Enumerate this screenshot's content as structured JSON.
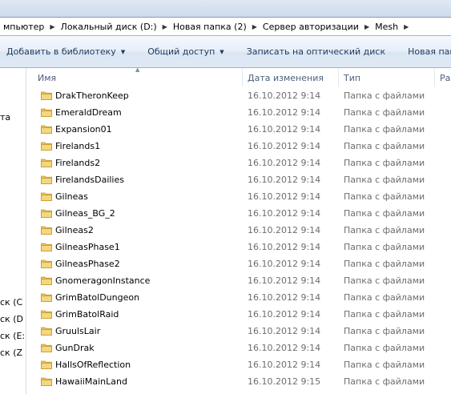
{
  "breadcrumb": {
    "items": [
      "мпьютер",
      "Локальный диск (D:)",
      "Новая папка (2)",
      "Сервер авторизации",
      "Mesh"
    ],
    "separator_icon": "chevron-right-icon"
  },
  "toolbar": {
    "library_label": "Добавить в библиотеку",
    "share_label": "Общий доступ",
    "burn_label": "Записать на оптический диск",
    "new_folder_label": "Новая папка"
  },
  "nav": {
    "items": [
      "та",
      "ск (C",
      "ск (D",
      "ск (E:",
      "ск (Z"
    ]
  },
  "columns": {
    "name": "Имя",
    "date": "Дата изменения",
    "type": "Тип",
    "size": "Ра"
  },
  "files": [
    {
      "name": "DrakTheronKeep",
      "date": "16.10.2012 9:14",
      "type": "Папка с файлами"
    },
    {
      "name": "EmeraldDream",
      "date": "16.10.2012 9:14",
      "type": "Папка с файлами"
    },
    {
      "name": "Expansion01",
      "date": "16.10.2012 9:14",
      "type": "Папка с файлами"
    },
    {
      "name": "Firelands1",
      "date": "16.10.2012 9:14",
      "type": "Папка с файлами"
    },
    {
      "name": "Firelands2",
      "date": "16.10.2012 9:14",
      "type": "Папка с файлами"
    },
    {
      "name": "FirelandsDailies",
      "date": "16.10.2012 9:14",
      "type": "Папка с файлами"
    },
    {
      "name": "Gilneas",
      "date": "16.10.2012 9:14",
      "type": "Папка с файлами"
    },
    {
      "name": "Gilneas_BG_2",
      "date": "16.10.2012 9:14",
      "type": "Папка с файлами"
    },
    {
      "name": "Gilneas2",
      "date": "16.10.2012 9:14",
      "type": "Папка с файлами"
    },
    {
      "name": "GilneasPhase1",
      "date": "16.10.2012 9:14",
      "type": "Папка с файлами"
    },
    {
      "name": "GilneasPhase2",
      "date": "16.10.2012 9:14",
      "type": "Папка с файлами"
    },
    {
      "name": "GnomeragonInstance",
      "date": "16.10.2012 9:14",
      "type": "Папка с файлами"
    },
    {
      "name": "GrimBatolDungeon",
      "date": "16.10.2012 9:14",
      "type": "Папка с файлами"
    },
    {
      "name": "GrimBatolRaid",
      "date": "16.10.2012 9:14",
      "type": "Папка с файлами"
    },
    {
      "name": "GruulsLair",
      "date": "16.10.2012 9:14",
      "type": "Папка с файлами"
    },
    {
      "name": "GunDrak",
      "date": "16.10.2012 9:14",
      "type": "Папка с файлами"
    },
    {
      "name": "HallsOfReflection",
      "date": "16.10.2012 9:14",
      "type": "Папка с файлами"
    },
    {
      "name": "HawaiiMainLand",
      "date": "16.10.2012 9:15",
      "type": "Папка с файлами"
    }
  ]
}
